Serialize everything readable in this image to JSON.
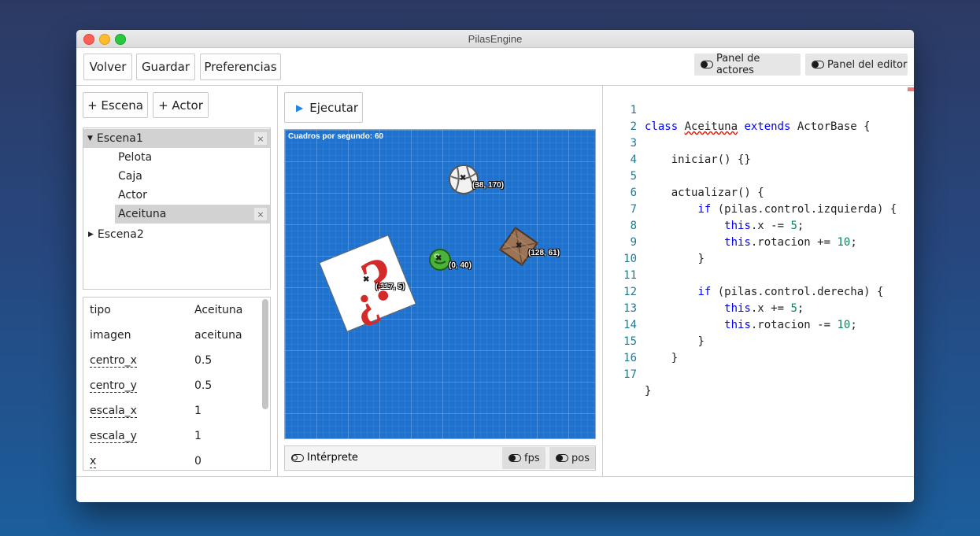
{
  "window": {
    "title": "PilasEngine"
  },
  "toolbar": {
    "back_label": "Volver",
    "save_label": "Guardar",
    "prefs_label": "Preferencias",
    "actors_panel_label": "Panel de actores",
    "editor_panel_label": "Panel del editor"
  },
  "left": {
    "add_scene_label": "+ Escena",
    "add_actor_label": "+ Actor",
    "tree": {
      "scene1": "Escena1",
      "actors": [
        "Pelota",
        "Caja",
        "Actor",
        "Aceituna"
      ],
      "scene2": "Escena2",
      "close_glyph": "×",
      "selected_actor": "Aceituna"
    },
    "properties": [
      {
        "key": "tipo",
        "value": "Aceituna",
        "editable": false
      },
      {
        "key": "imagen",
        "value": "aceituna",
        "editable": false
      },
      {
        "key": "centro_x",
        "value": "0.5",
        "editable": true
      },
      {
        "key": "centro_y",
        "value": "0.5",
        "editable": true
      },
      {
        "key": "escala_x",
        "value": "1",
        "editable": true
      },
      {
        "key": "escala_y",
        "value": "1",
        "editable": true
      },
      {
        "key": "x",
        "value": "0",
        "editable": true
      }
    ]
  },
  "center": {
    "run_label": "Ejecutar",
    "fps_text": "Cuadros por segundo: 60",
    "actors": {
      "ball_coord": "(38, 170)",
      "box_coord": "(128, 61)",
      "olive_coord": "(0, 40)",
      "unknown_coord": "(-117, 5)",
      "x_glyph": "✖"
    },
    "bottom": {
      "interpreter_label": "Intérprete",
      "fps_label": "fps",
      "pos_label": "pos"
    }
  },
  "editor": {
    "line_numbers": [
      "1",
      "2",
      "3",
      "4",
      "5",
      "6",
      "7",
      "8",
      "9",
      "10",
      "11",
      "12",
      "13",
      "14",
      "15",
      "16",
      "17"
    ],
    "code": {
      "l1_class": "class ",
      "l1_name": "Aceituna",
      "l1_extends": " extends ",
      "l1_rest": "ActorBase {",
      "l3": "    iniciar() {}",
      "l5": "    actualizar() {",
      "if": "if",
      "l6_rest": " (pilas.control.izquierda) {",
      "this": "this",
      "l7_rest": ".x -= ",
      "l7_num": "5",
      "l8_rest": ".rotacion += ",
      "l8_num": "10",
      "semi": ";",
      "close_brace": "}",
      "l11_rest": " (pilas.control.derecha) {",
      "l12_rest": ".x += ",
      "l12_num": "5",
      "l13_rest": ".rotacion -= ",
      "l13_num": "10"
    }
  },
  "colors": {
    "canvas_bg": "#1f73cf",
    "keyword": "#0000ff",
    "number": "#098658",
    "line_number": "#237893",
    "run_icon": "#1e88e5"
  }
}
